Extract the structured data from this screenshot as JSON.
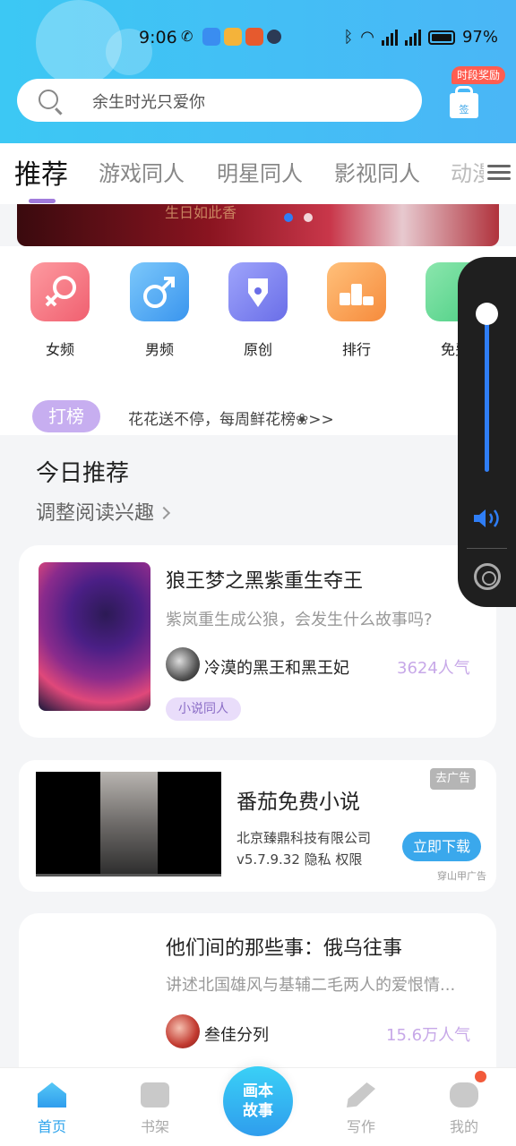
{
  "status_bar": {
    "time": "9:06",
    "battery": "97%",
    "network": "4G"
  },
  "search": {
    "placeholder": "余生时光只爱你"
  },
  "reward": {
    "badge": "时段奖励",
    "gift_label": "签"
  },
  "tabs": [
    {
      "label": "推荐",
      "active": true
    },
    {
      "label": "游戏同人",
      "active": false
    },
    {
      "label": "明星同人",
      "active": false
    },
    {
      "label": "影视同人",
      "active": false
    },
    {
      "label": "动漫",
      "active": false
    }
  ],
  "banner": {
    "text": "生日如此香"
  },
  "categories": [
    {
      "label": "女频",
      "icon": "female-icon",
      "color": "#f77a82"
    },
    {
      "label": "男频",
      "icon": "male-icon",
      "color": "#49a9f1"
    },
    {
      "label": "原创",
      "icon": "pen-icon",
      "color": "#7b7ff2"
    },
    {
      "label": "排行",
      "icon": "podium-icon",
      "color": "#f9a15a"
    },
    {
      "label": "免费",
      "icon": "free-icon",
      "color": "#5fd38e"
    }
  ],
  "ticker": {
    "badge": "打榜",
    "text": "花花送不停，每周鲜花榜❀>>"
  },
  "recommend": {
    "title": "今日推荐",
    "adjust": "调整阅读兴趣"
  },
  "books": [
    {
      "title": "狼王梦之黑紫重生夺王",
      "desc": "紫岚重生成公狼，会发生什么故事吗?",
      "author": "冷漠的黑王和黑王妃",
      "popularity": "3624人气",
      "tag": "小说同人"
    },
    {
      "title": "他们间的那些事：俄乌往事",
      "desc": "讲述北国雄风与基辅二毛两人的爱恨情...",
      "author": "叁佳分列",
      "popularity": "15.6万人气"
    }
  ],
  "ad": {
    "title": "番茄免费小说",
    "company": "北京臻鼎科技有限公司",
    "version": "v5.7.9.32  隐私  权限",
    "remove": "去广告",
    "download": "立即下载",
    "source": "穿山甲广告"
  },
  "bottom_nav": [
    {
      "label": "首页",
      "icon": "home-icon",
      "active": true
    },
    {
      "label": "书架",
      "icon": "bookshelf-icon",
      "active": false
    },
    {
      "label": "写作",
      "icon": "write-icon",
      "active": false
    },
    {
      "label": "我的",
      "icon": "profile-icon",
      "active": false
    }
  ],
  "center_button": {
    "line1": "画本",
    "line2": "故事"
  },
  "volume_panel": {
    "level": 0.95
  },
  "colors": {
    "accent": "#2fa4ec",
    "purple": "#a17bdc",
    "header": "#3cc8f4"
  }
}
